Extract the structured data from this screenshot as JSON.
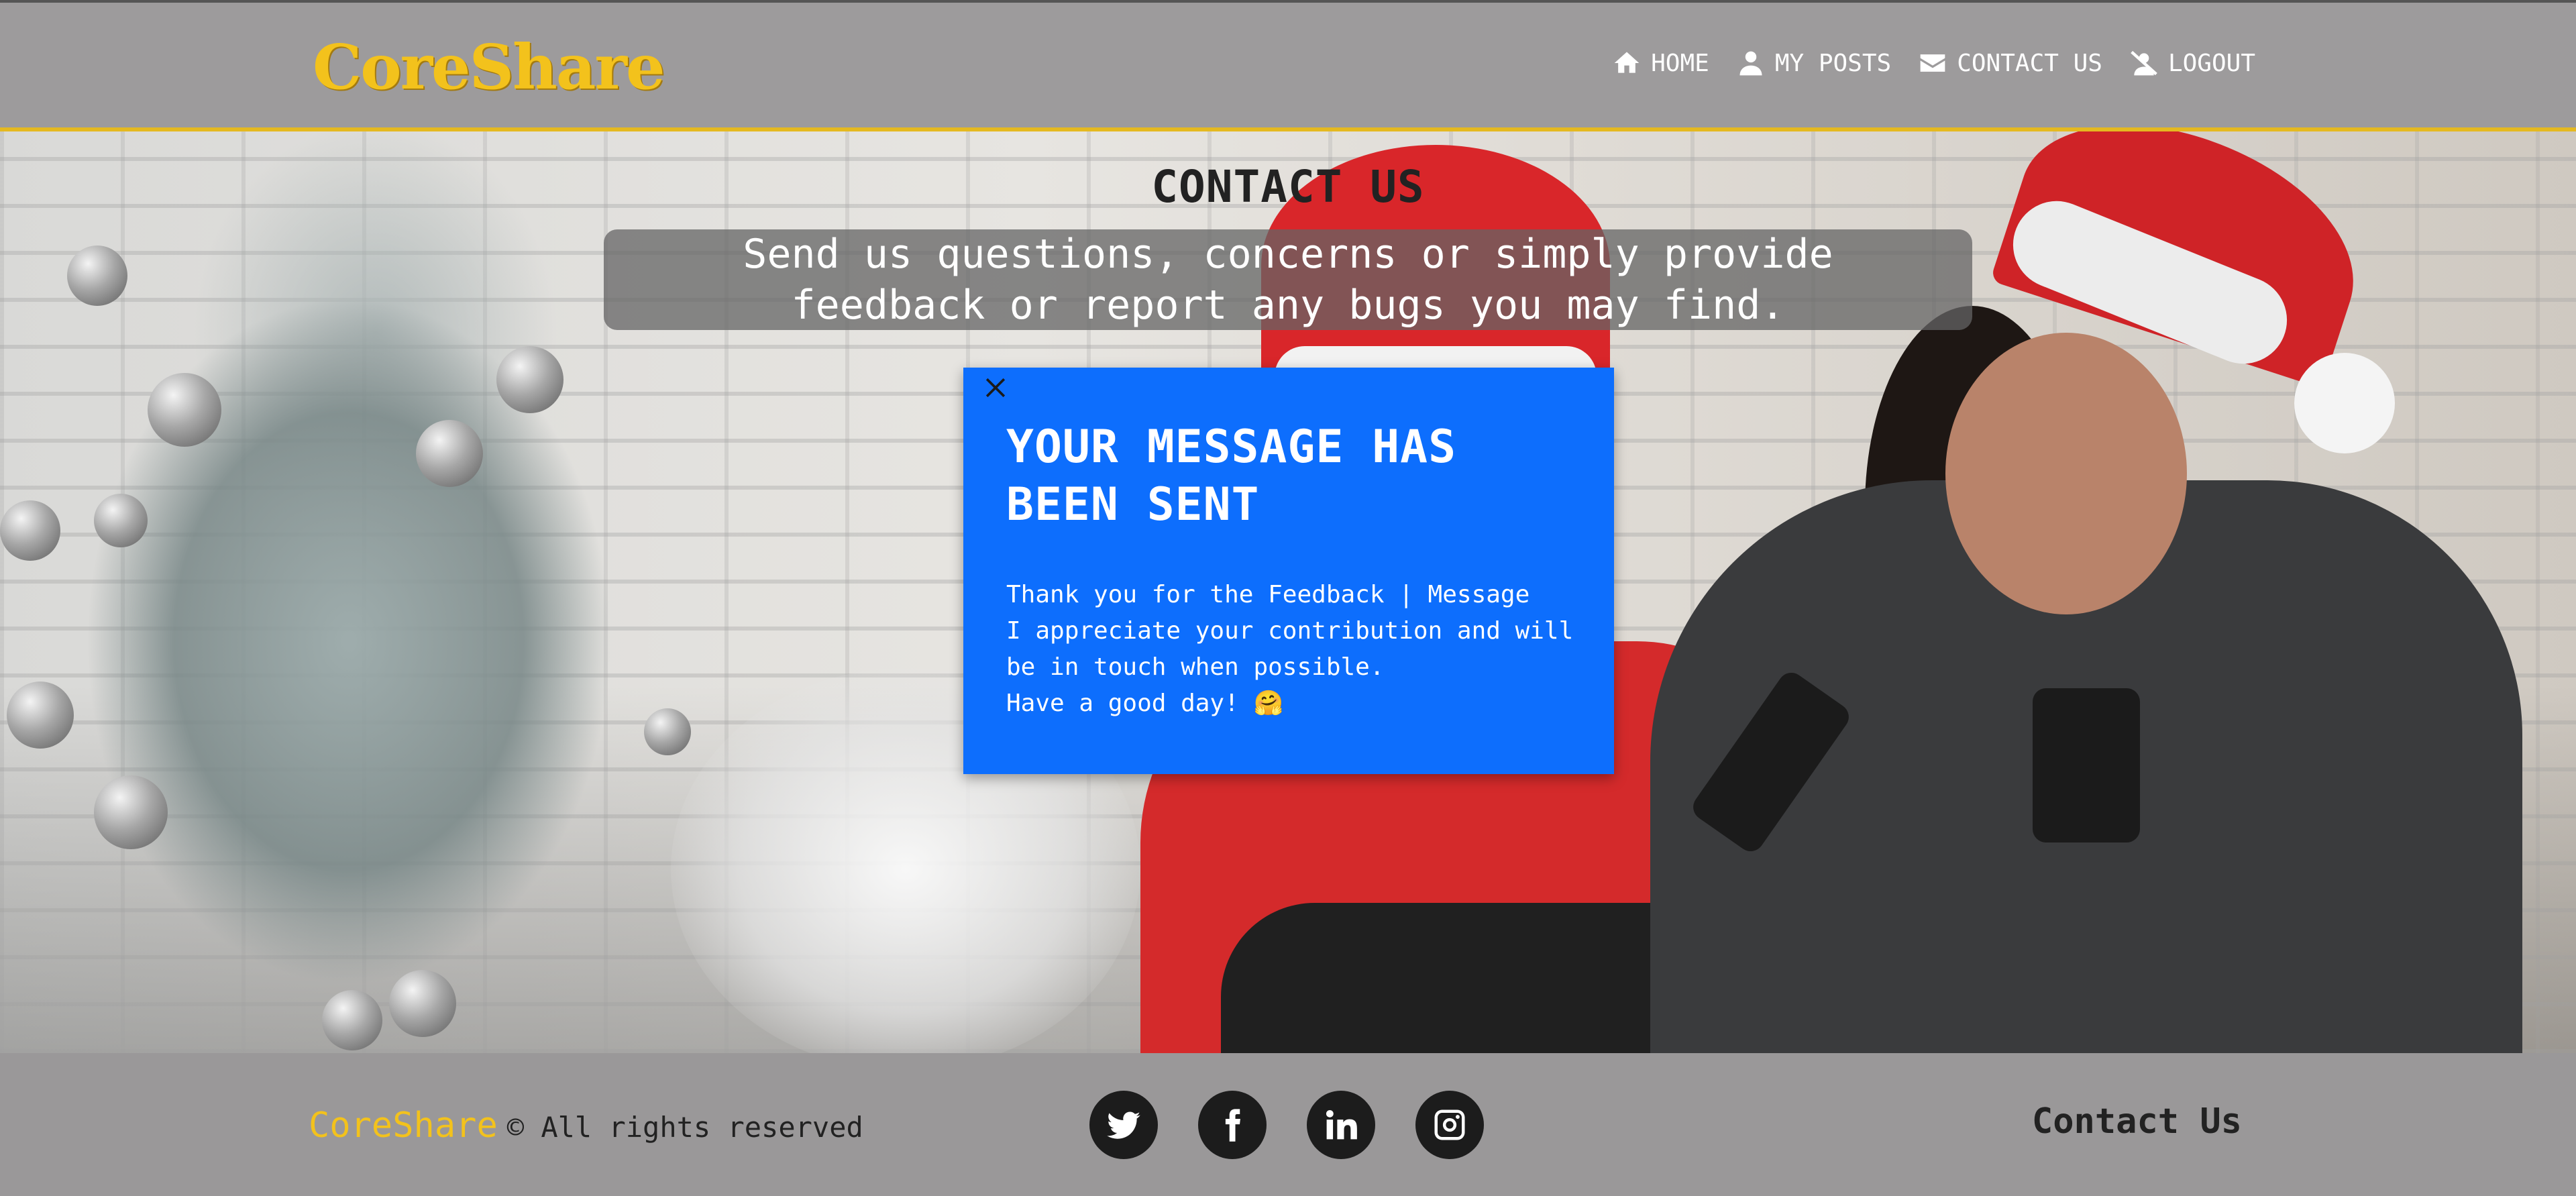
{
  "header": {
    "logo": "CoreShare",
    "nav": [
      {
        "label": "HOME",
        "icon": "home-icon"
      },
      {
        "label": "MY POSTS",
        "icon": "user-icon"
      },
      {
        "label": "CONTACT US",
        "icon": "envelope-icon"
      },
      {
        "label": "LOGOUT",
        "icon": "user-slash-icon"
      }
    ]
  },
  "hero": {
    "title": "CONTACT US",
    "subtitle": "Send us questions, concerns or simply provide feedback or report any bugs you may find."
  },
  "modal": {
    "close_icon": "close-icon",
    "title": "YOUR MESSAGE HAS BEEN SENT",
    "lines": [
      "Thank you for the Feedback | Message",
      "I appreciate your contribution and will be in touch when possible.",
      "Have a good day! 🤗"
    ],
    "background_color": "#0d6efd"
  },
  "footer": {
    "brand": "CoreShare",
    "rights": "© All rights reserved",
    "social": [
      "twitter-icon",
      "facebook-icon",
      "linkedin-icon",
      "instagram-icon"
    ],
    "contact_label": "Contact Us"
  },
  "colors": {
    "accent": "#f3c21c",
    "nav_background": "#9d9b9c",
    "modal": "#0d6efd"
  }
}
